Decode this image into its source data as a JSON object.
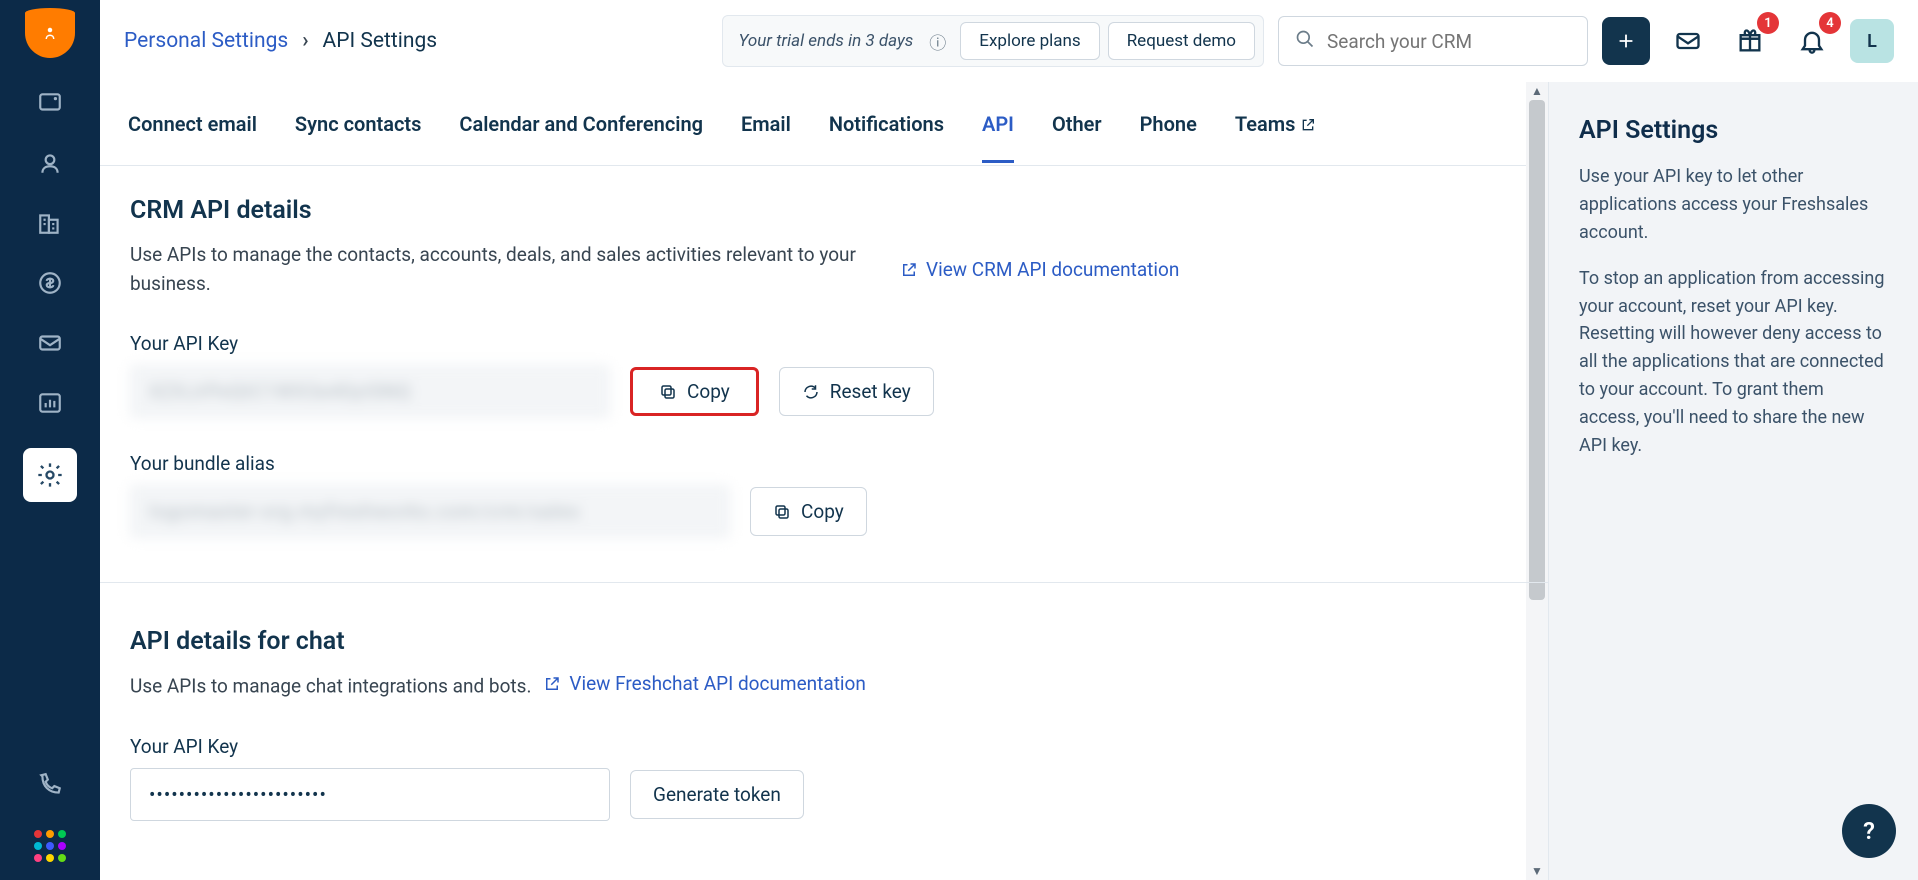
{
  "top": {
    "breadcrumb_parent": "Personal Settings",
    "breadcrumb_current": "API Settings",
    "trial_text": "Your trial ends in 3 days",
    "explore_plans": "Explore plans",
    "request_demo": "Request demo",
    "search_placeholder": "Search your CRM",
    "gift_badge": "1",
    "bell_badge": "4",
    "avatar_letter": "L"
  },
  "tabs": {
    "t0": "Connect email",
    "t1": "Sync contacts",
    "t2": "Calendar and Conferencing",
    "t3": "Email",
    "t4": "Notifications",
    "t5": "API",
    "t6": "Other",
    "t7": "Phone",
    "t8": "Teams"
  },
  "crm": {
    "heading": "CRM API details",
    "desc": "Use APIs to manage the contacts, accounts, deals, and sales activities relevant to your business.",
    "doc_link": "View CRM API documentation",
    "api_key_label": "Your API Key",
    "api_key_value": "XZXJrPeQtC1WX3e40ytSNQ",
    "copy": "Copy",
    "reset": "Reset key",
    "bundle_label": "Your bundle alias",
    "bundle_value": "logomaster-org.myfreshworks.com/crm/sales"
  },
  "chat": {
    "heading": "API details for chat",
    "desc": "Use APIs to manage chat integrations and bots.",
    "doc_link": "View Freshchat API documentation",
    "api_key_label": "Your API Key",
    "api_key_value": "••••••••••••••••••••••••",
    "generate": "Generate token"
  },
  "right": {
    "heading": "API Settings",
    "p1": "Use your API key to let other applications access your Freshsales account.",
    "p2": "To stop an application from accessing your account, reset your API key. Resetting will however deny access to all the applications that are connected to your account. To grant them access, you'll need to share the new API key."
  }
}
